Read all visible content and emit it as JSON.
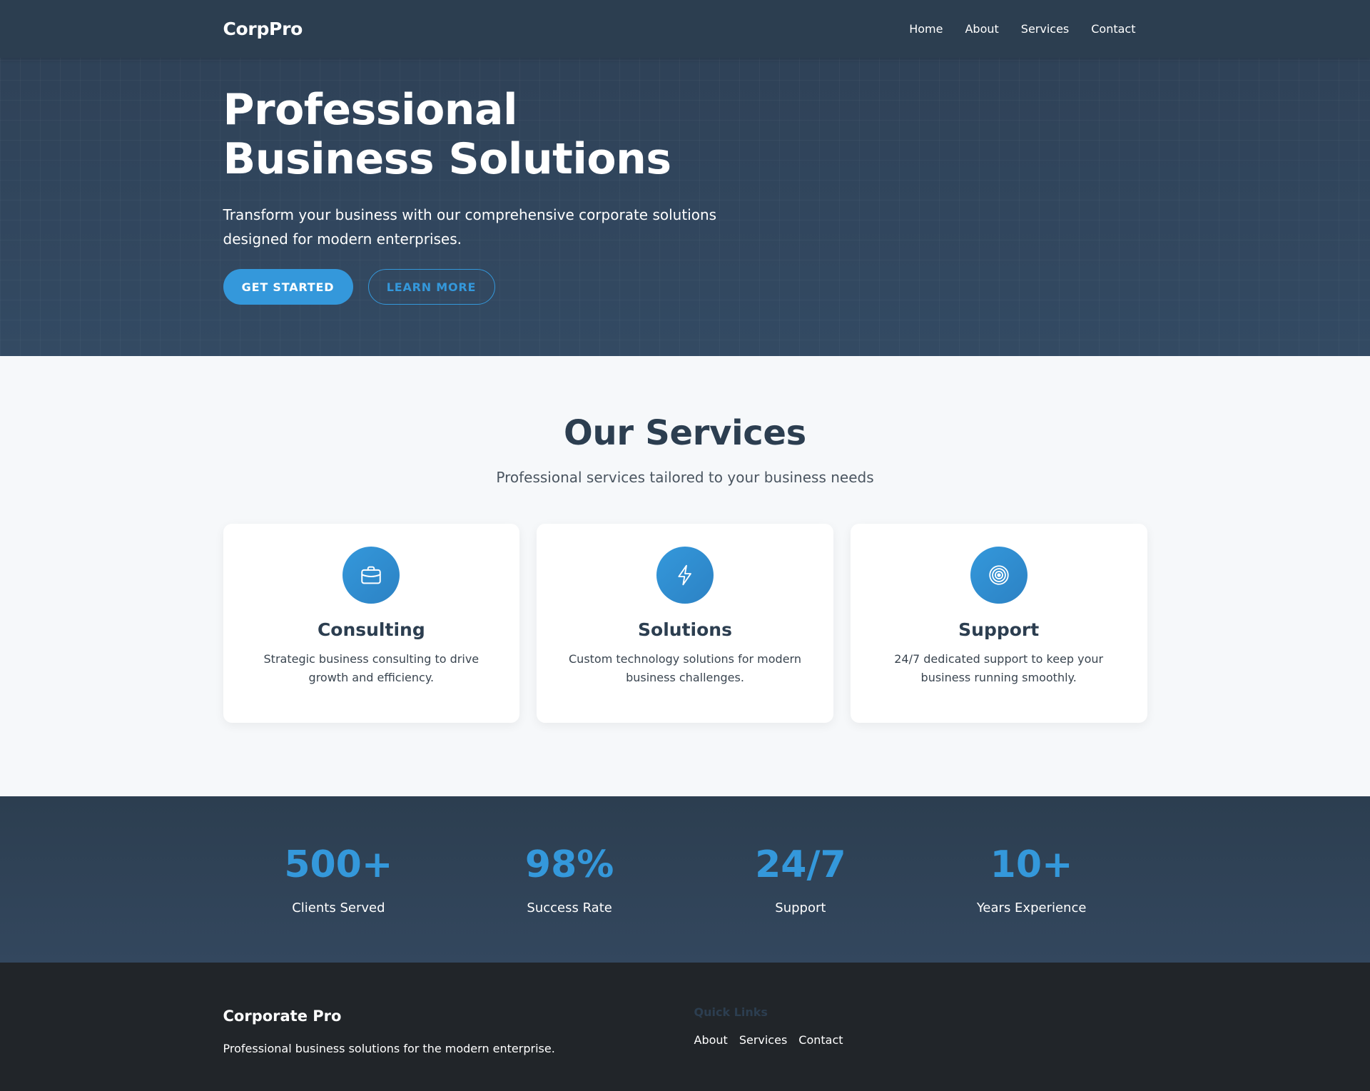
{
  "nav": {
    "logo": "CorpPro",
    "links": [
      "Home",
      "About",
      "Services",
      "Contact"
    ]
  },
  "hero": {
    "title": "Professional Business Solutions",
    "subtitle": "Transform your business with our comprehensive corporate solutions designed for modern enterprises.",
    "primary_button": "GET STARTED",
    "secondary_button": "LEARN MORE"
  },
  "services": {
    "title": "Our Services",
    "subtitle": "Professional services tailored to your business needs",
    "cards": [
      {
        "icon": "briefcase-icon",
        "title": "Consulting",
        "text": "Strategic business consulting to drive growth and efficiency."
      },
      {
        "icon": "lightning-icon",
        "title": "Solutions",
        "text": "Custom technology solutions for modern business challenges."
      },
      {
        "icon": "target-icon",
        "title": "Support",
        "text": "24/7 dedicated support to keep your business running smoothly."
      }
    ]
  },
  "stats": [
    {
      "value": "500+",
      "label": "Clients Served"
    },
    {
      "value": "98%",
      "label": "Success Rate"
    },
    {
      "value": "24/7",
      "label": "Support"
    },
    {
      "value": "10+",
      "label": "Years Experience"
    }
  ],
  "footer": {
    "brand": "Corporate Pro",
    "description": "Professional business solutions for the modern enterprise.",
    "quick_links_title": "Quick Links",
    "quick_links": [
      "About",
      "Services",
      "Contact"
    ]
  },
  "colors": {
    "primary": "#3498db",
    "dark": "#2c3e50",
    "footer": "#212529"
  }
}
